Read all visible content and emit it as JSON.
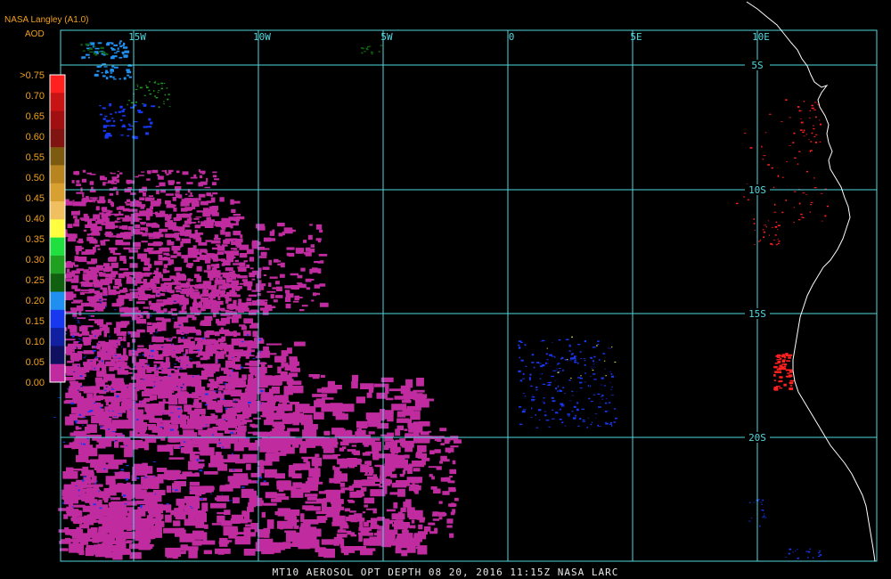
{
  "header": {
    "source": "NASA Langley (A1.0)",
    "product": "AOD"
  },
  "legend": {
    "labels": [
      ">0.75",
      "0.70",
      "0.65",
      "0.60",
      "0.55",
      "0.50",
      "0.45",
      "0.40",
      "0.35",
      "0.30",
      "0.25",
      "0.20",
      "0.15",
      "0.10",
      "0.05",
      "0.00"
    ],
    "colors": [
      "#ff2020",
      "#c81414",
      "#a01010",
      "#801410",
      "#7c5a10",
      "#b88420",
      "#d8a030",
      "#f0c060",
      "#ffff40",
      "#20e040",
      "#20a020",
      "#106010",
      "#2090f0",
      "#1838f0",
      "#1020a0",
      "#101060",
      "#c02ca0"
    ]
  },
  "grid": {
    "longitudes": [
      "15W",
      "10W",
      "5W",
      "0",
      "5E",
      "10E"
    ],
    "latitudes": [
      "5S",
      "10S",
      "15S",
      "20S"
    ]
  },
  "footer": {
    "text": "MT10  AEROSOL OPT DEPTH   08 20, 2016 11:15Z   NASA LARC"
  },
  "colors": {
    "grid": "#50d8e0",
    "coast": "#ffffff",
    "smoke_high": "#ff2020",
    "marine_low": "#c02ca0",
    "clean": "#1838f0"
  }
}
